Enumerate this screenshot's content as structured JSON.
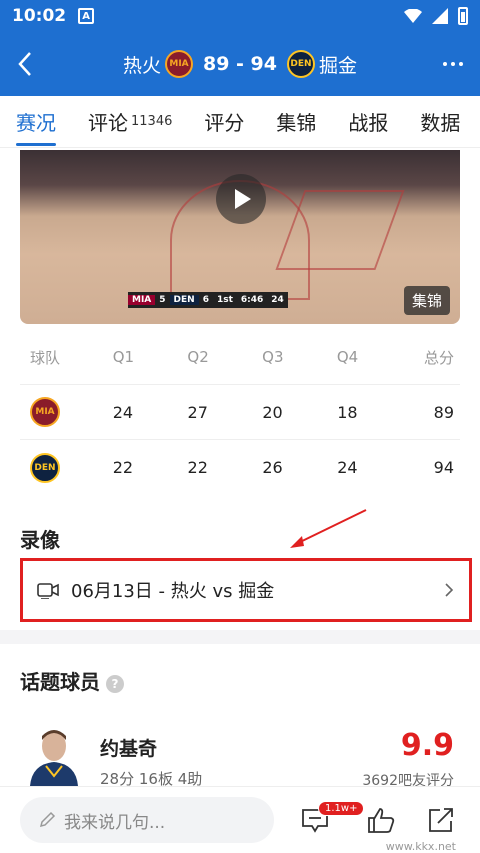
{
  "status_bar": {
    "time": "10:02",
    "notif_letter": "A"
  },
  "header": {
    "home_team": "热火",
    "home_abbr": "MIA",
    "away_team": "掘金",
    "away_abbr": "DEN",
    "score": "89 - 94"
  },
  "tabs": [
    {
      "label": "赛况",
      "active": true
    },
    {
      "label": "评论",
      "count": "11346"
    },
    {
      "label": "评分"
    },
    {
      "label": "集锦"
    },
    {
      "label": "战报"
    },
    {
      "label": "数据"
    }
  ],
  "video": {
    "badge": "集锦",
    "scorebug": {
      "home": "MIA",
      "home_score": "5",
      "away": "DEN",
      "away_score": "6",
      "quarter": "1st",
      "clock": "6:46",
      "shot_clock": "24"
    }
  },
  "score_table": {
    "headers": [
      "球队",
      "Q1",
      "Q2",
      "Q3",
      "Q4",
      "总分"
    ],
    "rows": [
      {
        "team": "MIA",
        "q": [
          "24",
          "27",
          "20",
          "18"
        ],
        "total": "89"
      },
      {
        "team": "DEN",
        "q": [
          "22",
          "22",
          "26",
          "24"
        ],
        "total": "94"
      }
    ]
  },
  "recording": {
    "title": "录像",
    "item": "06月13日 - 热火 vs 掘金"
  },
  "topic_players": {
    "title": "话题球员",
    "player": {
      "name": "约基奇",
      "stats": "28分 16板 4助",
      "rating": "9.9",
      "raters": "3692吧友评分"
    }
  },
  "bottom_bar": {
    "comment_placeholder": "我来说几句...",
    "comment_badge": "1.1w+"
  },
  "watermark": "www.kkx.net",
  "colors": {
    "brand": "#1e6fd0",
    "accent_red": "#e02020"
  }
}
